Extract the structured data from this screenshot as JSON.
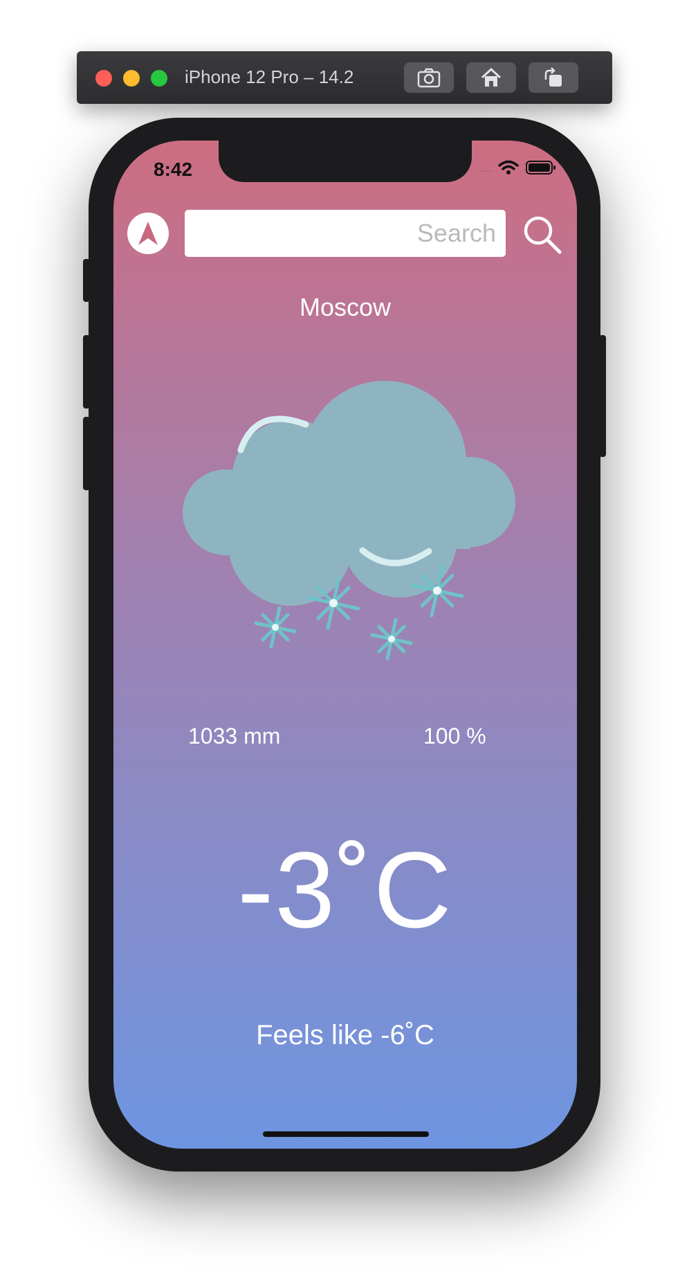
{
  "simulator": {
    "title": "iPhone 12 Pro – 14.2",
    "buttons": [
      {
        "icon": "camera-icon"
      },
      {
        "icon": "home-icon"
      },
      {
        "icon": "rotate-icon"
      }
    ]
  },
  "status_bar": {
    "time": "8:42",
    "signal": "....",
    "wifi_icon": "wifi-icon",
    "battery_icon": "battery-icon"
  },
  "header": {
    "location_icon": "location-arrow-icon",
    "search_placeholder": "Search",
    "search_value": "",
    "search_icon": "search-icon"
  },
  "weather": {
    "city": "Moscow",
    "condition_icon": "snow-cloud-icon",
    "pressure": "1033 mm",
    "humidity": "100 %",
    "temperature": "-3˚C",
    "feels_like": "Feels like -6˚C"
  },
  "colors": {
    "gradient_top": "#cd6d82",
    "gradient_bottom": "#6e95e1",
    "cloud": "#8fb4c1",
    "snowflake": "#6fc3c8"
  }
}
